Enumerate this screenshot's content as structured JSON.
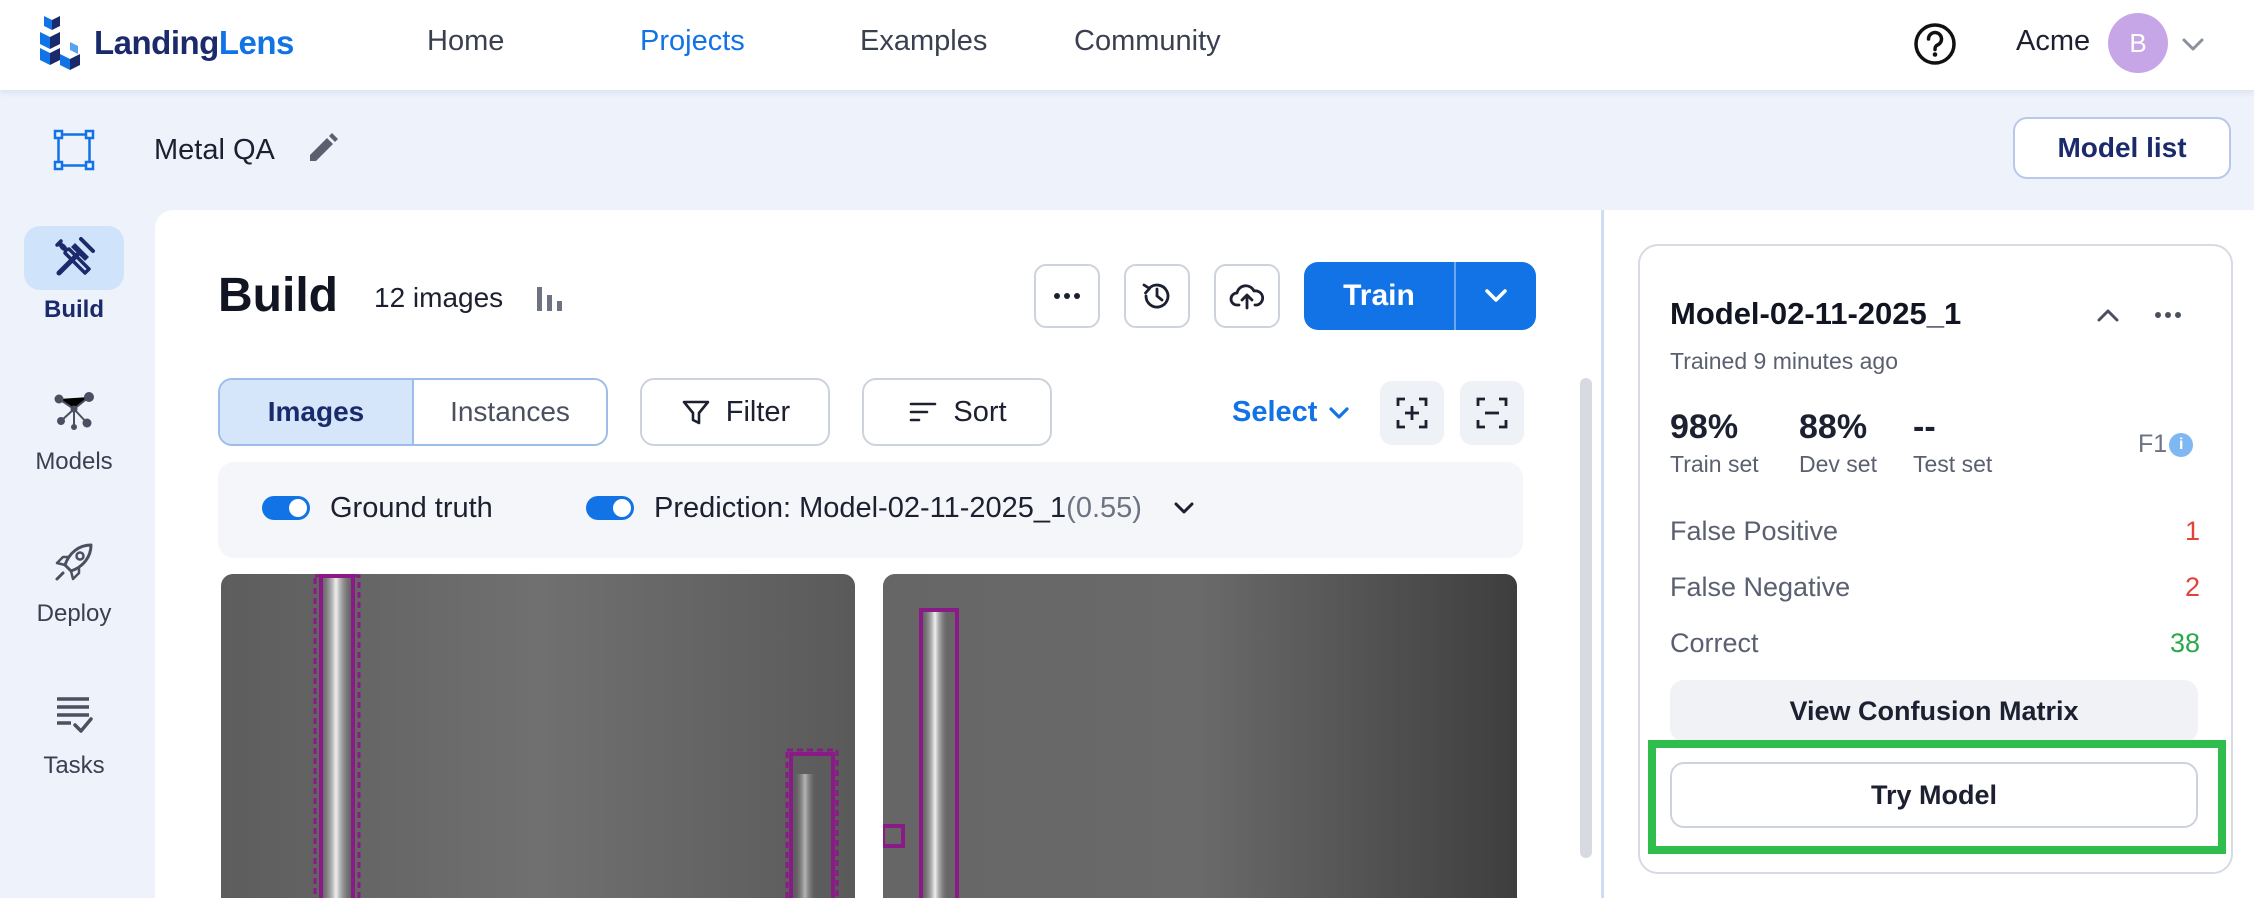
{
  "brand": {
    "name_part1": "Landing",
    "name_part2": "Lens"
  },
  "nav": {
    "home": "Home",
    "projects": "Projects",
    "examples": "Examples",
    "community": "Community",
    "active": "Projects"
  },
  "account": {
    "org": "Acme",
    "avatar_initial": "B"
  },
  "project": {
    "name": "Metal QA",
    "model_list_label": "Model list"
  },
  "rail": {
    "build": "Build",
    "models": "Models",
    "deploy": "Deploy",
    "tasks": "Tasks"
  },
  "build": {
    "title": "Build",
    "image_count": "12 images",
    "train_label": "Train"
  },
  "toolbar": {
    "tab_images": "Images",
    "tab_instances": "Instances",
    "filter": "Filter",
    "sort": "Sort",
    "select": "Select"
  },
  "toggles": {
    "ground_truth": "Ground truth",
    "prediction_prefix": "Prediction: Model-02-11-2025_1",
    "prediction_score": "(0.55)"
  },
  "model_card": {
    "name": "Model-02-11-2025_1",
    "trained": "Trained 9 minutes ago",
    "train_set_value": "98%",
    "train_set_label": "Train set",
    "dev_set_value": "88%",
    "dev_set_label": "Dev set",
    "test_set_value": "--",
    "test_set_label": "Test set",
    "metric_name": "F1",
    "false_positive_label": "False Positive",
    "false_positive_value": "1",
    "false_negative_label": "False Negative",
    "false_negative_value": "2",
    "correct_label": "Correct",
    "correct_value": "38",
    "view_confusion_label": "View Confusion Matrix",
    "try_model_label": "Try Model"
  },
  "colors": {
    "accent": "#1273e6",
    "brand_dark": "#1b2a6b",
    "highlight": "#2fbe4e",
    "annotation_box": "#8a1a86",
    "error": "#e0443a",
    "success": "#2aa84a"
  }
}
